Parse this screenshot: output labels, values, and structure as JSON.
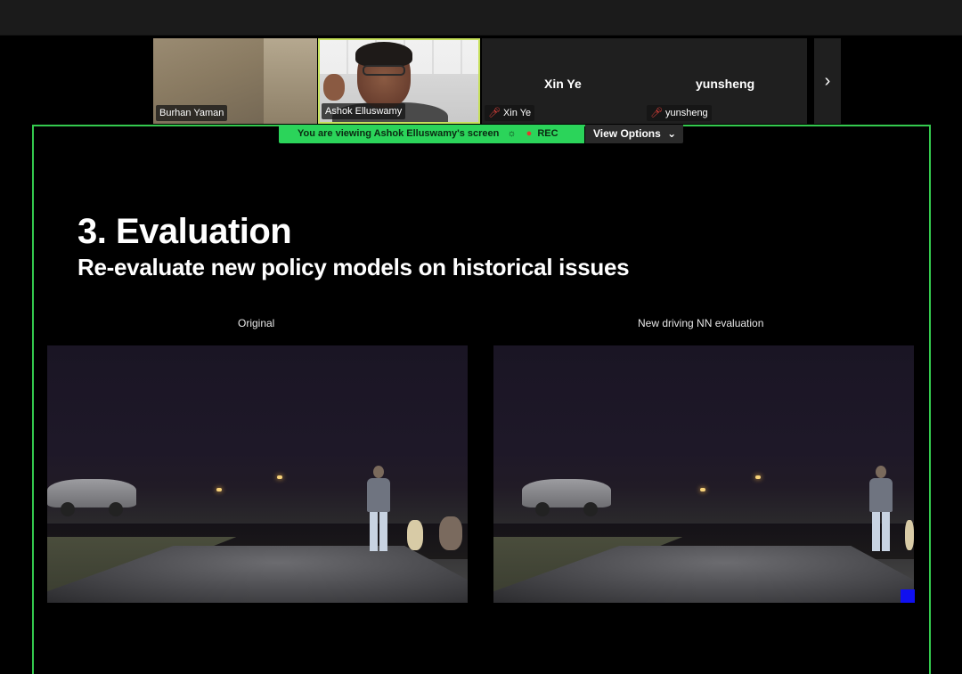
{
  "participants": [
    {
      "name": "Burhan Yaman",
      "has_video": true,
      "muted": false
    },
    {
      "name": "Ashok Elluswamy",
      "has_video": true,
      "muted": false,
      "active_speaker": true
    },
    {
      "name": "Xin Ye",
      "has_video": false,
      "muted": true
    },
    {
      "name": "yunsheng",
      "has_video": false,
      "muted": true
    }
  ],
  "icons": {
    "muted_mic": "muted-mic-icon",
    "next": "chevron-right-icon",
    "view_options_arrow": "chevron-down-icon",
    "share_status": "share-status-icon",
    "rec": "record-dot-icon"
  },
  "strip": {
    "next_glyph": "›"
  },
  "share_banner": {
    "text": "You are viewing  Ashok Elluswamy's screen",
    "rec_label": "REC",
    "view_options_label": "View Options"
  },
  "slide": {
    "title": "3. Evaluation",
    "subtitle": "Re-evaluate new policy models on historical issues",
    "left_caption": "Original",
    "right_caption": "New driving NN evaluation"
  },
  "colors": {
    "share_border": "#34c94e",
    "banner_bg": "#2bd45a",
    "active_speaker_border": "#c6e05a",
    "muted_icon": "#e0403a",
    "marker": "#1010f0"
  }
}
